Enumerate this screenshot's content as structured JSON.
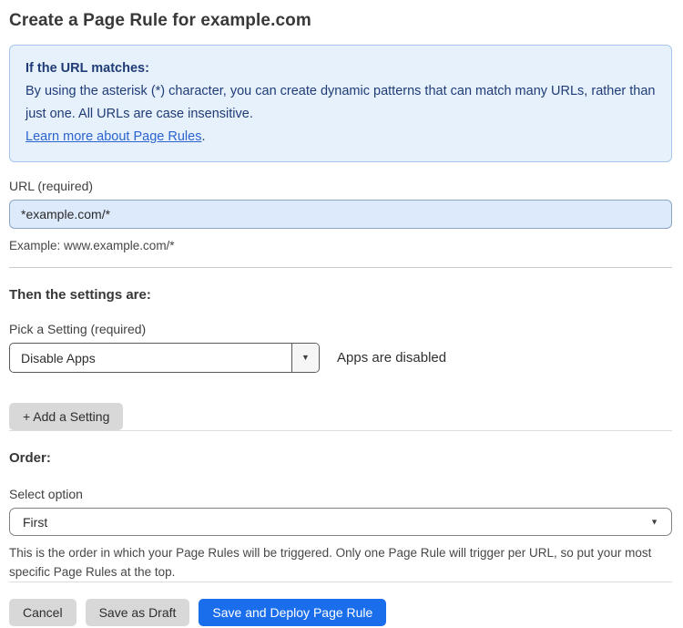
{
  "page": {
    "title": "Create a Page Rule for example.com"
  },
  "info_box": {
    "heading": "If the URL matches:",
    "body": "By using the asterisk (*) character, you can create dynamic patterns that can match many URLs, rather than just one. All URLs are case insensitive.",
    "link_label": "Learn more about Page Rules",
    "link_suffix": "."
  },
  "url_field": {
    "label": "URL (required)",
    "value": "*example.com/*",
    "helper": "Example: www.example.com/*"
  },
  "settings_section": {
    "heading": "Then the settings are:",
    "setting_label": "Pick a Setting (required)",
    "setting_value": "Disable Apps",
    "setting_status": "Apps are disabled",
    "add_setting_label": "+ Add a Setting"
  },
  "order_section": {
    "heading": "Order:",
    "select_label": "Select option",
    "select_value": "First",
    "helper": "This is the order in which your Page Rules will be triggered. Only one Page Rule will trigger per URL, so put your most specific Page Rules at the top."
  },
  "actions": {
    "cancel_label": "Cancel",
    "save_draft_label": "Save as Draft",
    "save_deploy_label": "Save and Deploy Page Rule"
  },
  "icons": {
    "dropdown_caret": "▼"
  },
  "colors": {
    "info_background": "#e7f1fb",
    "info_border": "#a8c7ee",
    "info_text": "#1f3c77",
    "link": "#2b63cf",
    "url_input_background": "#ddeafc",
    "primary_button": "#1a6eec",
    "secondary_button": "#d8d8d8"
  }
}
